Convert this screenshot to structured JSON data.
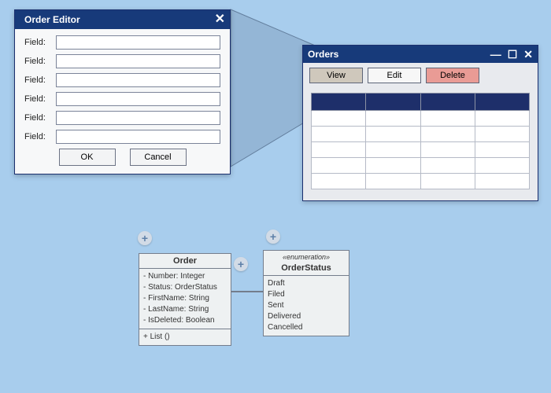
{
  "editor": {
    "title": "Order Editor",
    "fieldLabel": "Field:",
    "fieldCount": 6,
    "ok": "OK",
    "cancel": "Cancel"
  },
  "orders": {
    "title": "Orders",
    "toolbar": {
      "view": "View",
      "edit": "Edit",
      "del": "Delete"
    },
    "winControls": {
      "min": "—",
      "max": "☐",
      "close": "✕"
    },
    "cols": 4,
    "rows": 5
  },
  "uml": {
    "order": {
      "name": "Order",
      "attributes": [
        "- Number: Integer",
        "- Status: OrderStatus",
        "- FirstName: String",
        "- LastName: String",
        "- IsDeleted: Boolean"
      ],
      "operations": [
        "+ List ()"
      ]
    },
    "status": {
      "stereotype": "«enumeration»",
      "name": "OrderStatus",
      "literals": [
        "Draft",
        "Filed",
        "Sent",
        "Delivered",
        "Cancelled"
      ]
    }
  },
  "plusGlyph": "+"
}
